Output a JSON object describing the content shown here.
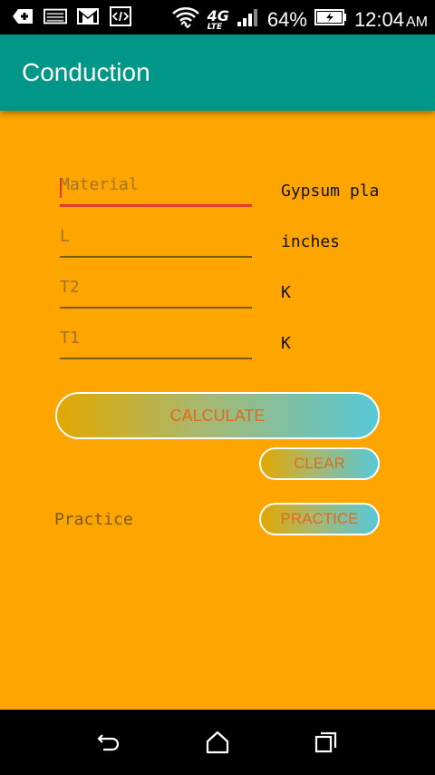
{
  "status_bar": {
    "battery_percent": "64%",
    "time": "12:04",
    "ampm": "AM",
    "network": "4G",
    "network_sub": "LTE",
    "icons": [
      "add-icon",
      "gallery-icon",
      "gmail-icon",
      "code-icon",
      "wifi-icon",
      "signal-icon",
      "battery-charging-icon"
    ]
  },
  "app_bar": {
    "title": "Conduction"
  },
  "form": {
    "material": {
      "placeholder": "Material",
      "value": "",
      "unit": "Gypsum pla"
    },
    "length": {
      "placeholder": "L",
      "value": "",
      "unit": "inches"
    },
    "t2": {
      "placeholder": "T2",
      "value": "",
      "unit": "K"
    },
    "t1": {
      "placeholder": "T1",
      "value": "",
      "unit": "K"
    }
  },
  "buttons": {
    "calculate": "CALCULATE",
    "clear": "CLEAR",
    "practice": "PRACTICE"
  },
  "practice_label": "Practice",
  "colors": {
    "background": "#ffa500",
    "app_bar": "#009688",
    "button_text": "#e06a1e",
    "focus_underline": "#e53935"
  },
  "nav_bar": {
    "icons": [
      "back-icon",
      "home-icon",
      "recents-icon"
    ]
  }
}
